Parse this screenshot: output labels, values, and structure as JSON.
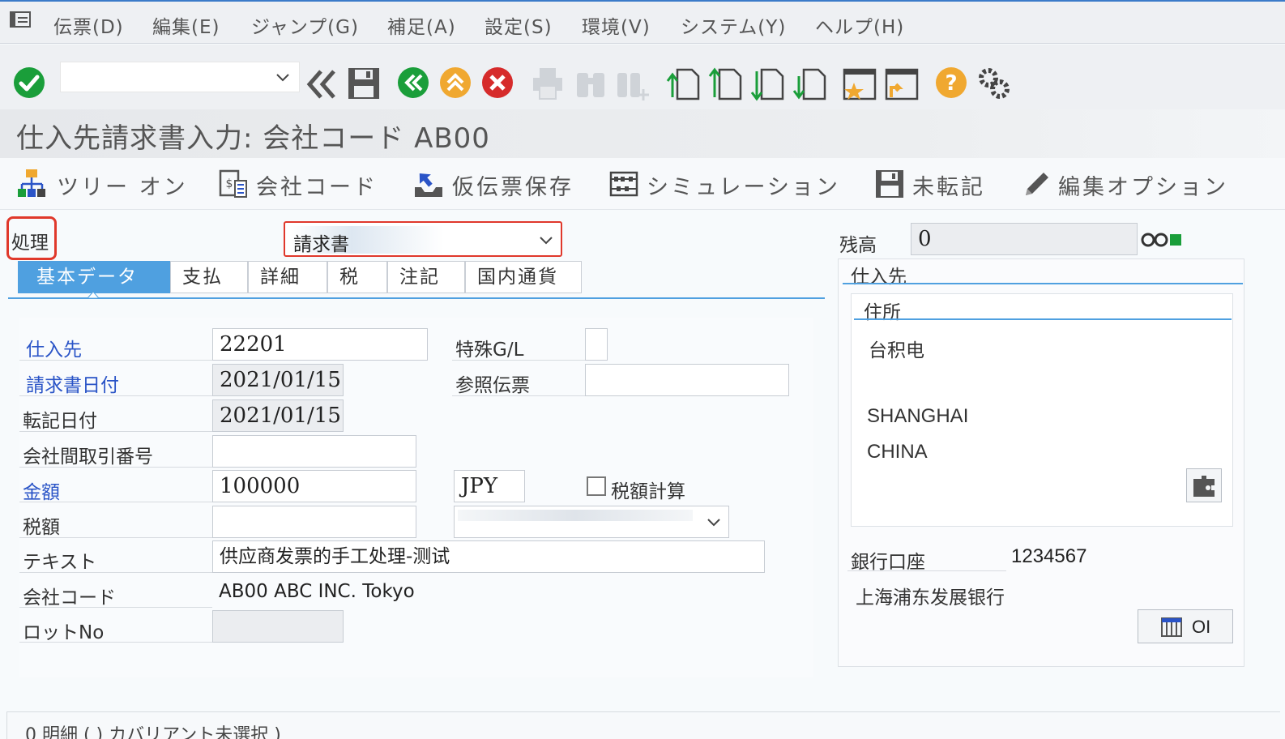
{
  "menu": {
    "items": [
      "伝票(D)",
      "編集(E)",
      "ジャンプ(G)",
      "補足(A)",
      "設定(S)",
      "環境(V)",
      "システム(Y)",
      "ヘルプ(H)"
    ]
  },
  "toolbar": {
    "command_value": ""
  },
  "title": "仕入先請求書入力: 会社コード AB00",
  "app_toolbar": {
    "tree_on": "ツリー オン",
    "company_code": "会社コード",
    "park": "仮伝票保存",
    "simulation": "シミュレーション",
    "hold": "未転記",
    "edit_options": "編集オプション"
  },
  "transaction": {
    "label": "処理",
    "value": "請求書"
  },
  "tabs": [
    "基本データ",
    "支払",
    "詳細",
    "税",
    "注記",
    "国内通貨"
  ],
  "basic": {
    "vendor_label": "仕入先",
    "vendor_value": "22201",
    "special_gl_label": "特殊G/L",
    "special_gl_value": "",
    "invoice_date_label": "請求書日付",
    "invoice_date_value": "2021/01/15",
    "reference_label": "参照伝票",
    "reference_value": "",
    "posting_date_label": "転記日付",
    "posting_date_value": "2021/01/15",
    "cross_cc_label": "会社間取引番号",
    "cross_cc_value": "",
    "amount_label": "金額",
    "amount_value": "100000",
    "currency_value": "JPY",
    "calc_tax_label": "税額計算",
    "tax_label": "税額",
    "tax_value": "",
    "text_label": "テキスト",
    "text_value": "供应商发票的手工处理-测试",
    "company_code_label": "会社コード",
    "company_code_value": "AB00 ABC INC. Tokyo",
    "lot_label": "ロットNo",
    "lot_value": ""
  },
  "balance": {
    "label": "残高",
    "value": "0"
  },
  "vendor_panel": {
    "title": "仕入先",
    "address_title": "住所",
    "name": "台积电",
    "city": "SHANGHAI",
    "country": "CHINA",
    "bank_account_label": "銀行口座",
    "bank_account_value": "1234567",
    "bank_name": "上海浦东发展银行",
    "oi_button": "OI"
  },
  "bottom_text": "0 明細 ( ) カバリアント未選択 )",
  "colors": {
    "accent_blue": "#4fa0e0",
    "link_blue": "#2a54c7",
    "highlight_red": "#e0382b",
    "status_green": "#1a9e3a"
  }
}
